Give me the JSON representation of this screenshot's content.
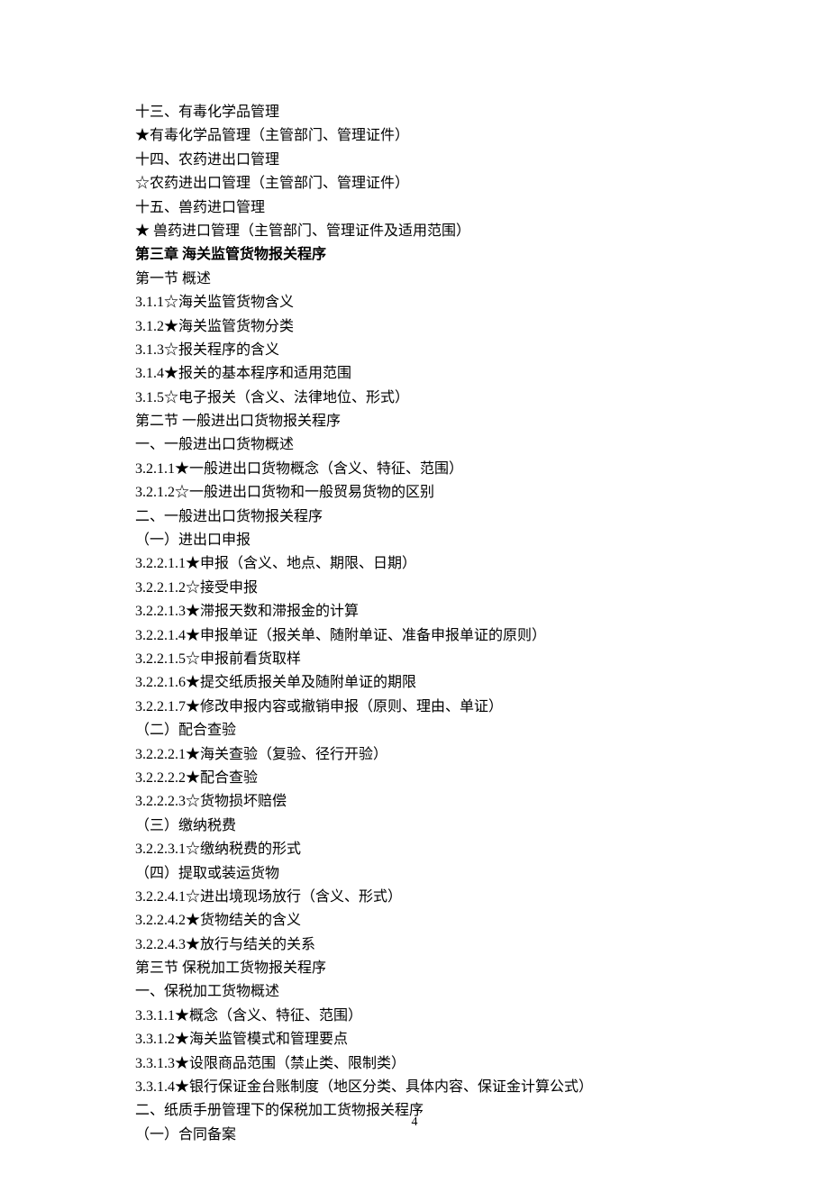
{
  "lines": [
    {
      "text": "十三、有毒化学品管理",
      "bold": false
    },
    {
      "text": "★有毒化学品管理（主管部门、管理证件）",
      "bold": false
    },
    {
      "text": "十四、农药进出口管理",
      "bold": false
    },
    {
      "text": "☆农药进出口管理（主管部门、管理证件）",
      "bold": false
    },
    {
      "text": "十五、兽药进口管理",
      "bold": false
    },
    {
      "text": "★  兽药进口管理（主管部门、管理证件及适用范围）",
      "bold": false
    },
    {
      "text": "第三章   海关监管货物报关程序",
      "bold": true
    },
    {
      "text": "第一节   概述",
      "bold": false
    },
    {
      "text": "3.1.1☆海关监管货物含义",
      "bold": false
    },
    {
      "text": "3.1.2★海关监管货物分类",
      "bold": false
    },
    {
      "text": "3.1.3☆报关程序的含义",
      "bold": false
    },
    {
      "text": "3.1.4★报关的基本程序和适用范围",
      "bold": false
    },
    {
      "text": "3.1.5☆电子报关（含义、法律地位、形式）",
      "bold": false
    },
    {
      "text": "第二节   一般进出口货物报关程序",
      "bold": false
    },
    {
      "text": "一、一般进出口货物概述",
      "bold": false
    },
    {
      "text": "3.2.1.1★一般进出口货物概念（含义、特征、范围）",
      "bold": false
    },
    {
      "text": "3.2.1.2☆一般进出口货物和一般贸易货物的区别",
      "bold": false
    },
    {
      "text": "二、一般进出口货物报关程序",
      "bold": false
    },
    {
      "text": "（一）进出口申报",
      "bold": false
    },
    {
      "text": "3.2.2.1.1★申报（含义、地点、期限、日期）",
      "bold": false
    },
    {
      "text": "3.2.2.1.2☆接受申报",
      "bold": false
    },
    {
      "text": "3.2.2.1.3★滞报天数和滞报金的计算",
      "bold": false
    },
    {
      "text": "3.2.2.1.4★申报单证（报关单、随附单证、准备申报单证的原则）",
      "bold": false
    },
    {
      "text": "3.2.2.1.5☆申报前看货取样",
      "bold": false
    },
    {
      "text": "3.2.2.1.6★提交纸质报关单及随附单证的期限",
      "bold": false
    },
    {
      "text": "3.2.2.1.7★修改申报内容或撤销申报（原则、理由、单证）",
      "bold": false
    },
    {
      "text": "（二）配合查验",
      "bold": false
    },
    {
      "text": "3.2.2.2.1★海关查验（复验、径行开验）",
      "bold": false
    },
    {
      "text": "3.2.2.2.2★配合查验",
      "bold": false
    },
    {
      "text": "3.2.2.2.3☆货物损坏赔偿",
      "bold": false
    },
    {
      "text": "（三）缴纳税费",
      "bold": false
    },
    {
      "text": "3.2.2.3.1☆缴纳税费的形式",
      "bold": false
    },
    {
      "text": "（四）提取或装运货物",
      "bold": false
    },
    {
      "text": "3.2.2.4.1☆进出境现场放行（含义、形式）",
      "bold": false
    },
    {
      "text": "3.2.2.4.2★货物结关的含义",
      "bold": false
    },
    {
      "text": "3.2.2.4.3★放行与结关的关系",
      "bold": false
    },
    {
      "text": "第三节   保税加工货物报关程序",
      "bold": false
    },
    {
      "text": "一、保税加工货物概述",
      "bold": false
    },
    {
      "text": "3.3.1.1★概念（含义、特征、范围）",
      "bold": false
    },
    {
      "text": "3.3.1.2★海关监管模式和管理要点",
      "bold": false
    },
    {
      "text": "3.3.1.3★设限商品范围（禁止类、限制类）",
      "bold": false
    },
    {
      "text": "3.3.1.4★银行保证金台账制度（地区分类、具体内容、保证金计算公式）",
      "bold": false
    },
    {
      "text": "二、纸质手册管理下的保税加工货物报关程序",
      "bold": false
    },
    {
      "text": "（一）合同备案",
      "bold": false
    }
  ],
  "pageNumber": "4"
}
